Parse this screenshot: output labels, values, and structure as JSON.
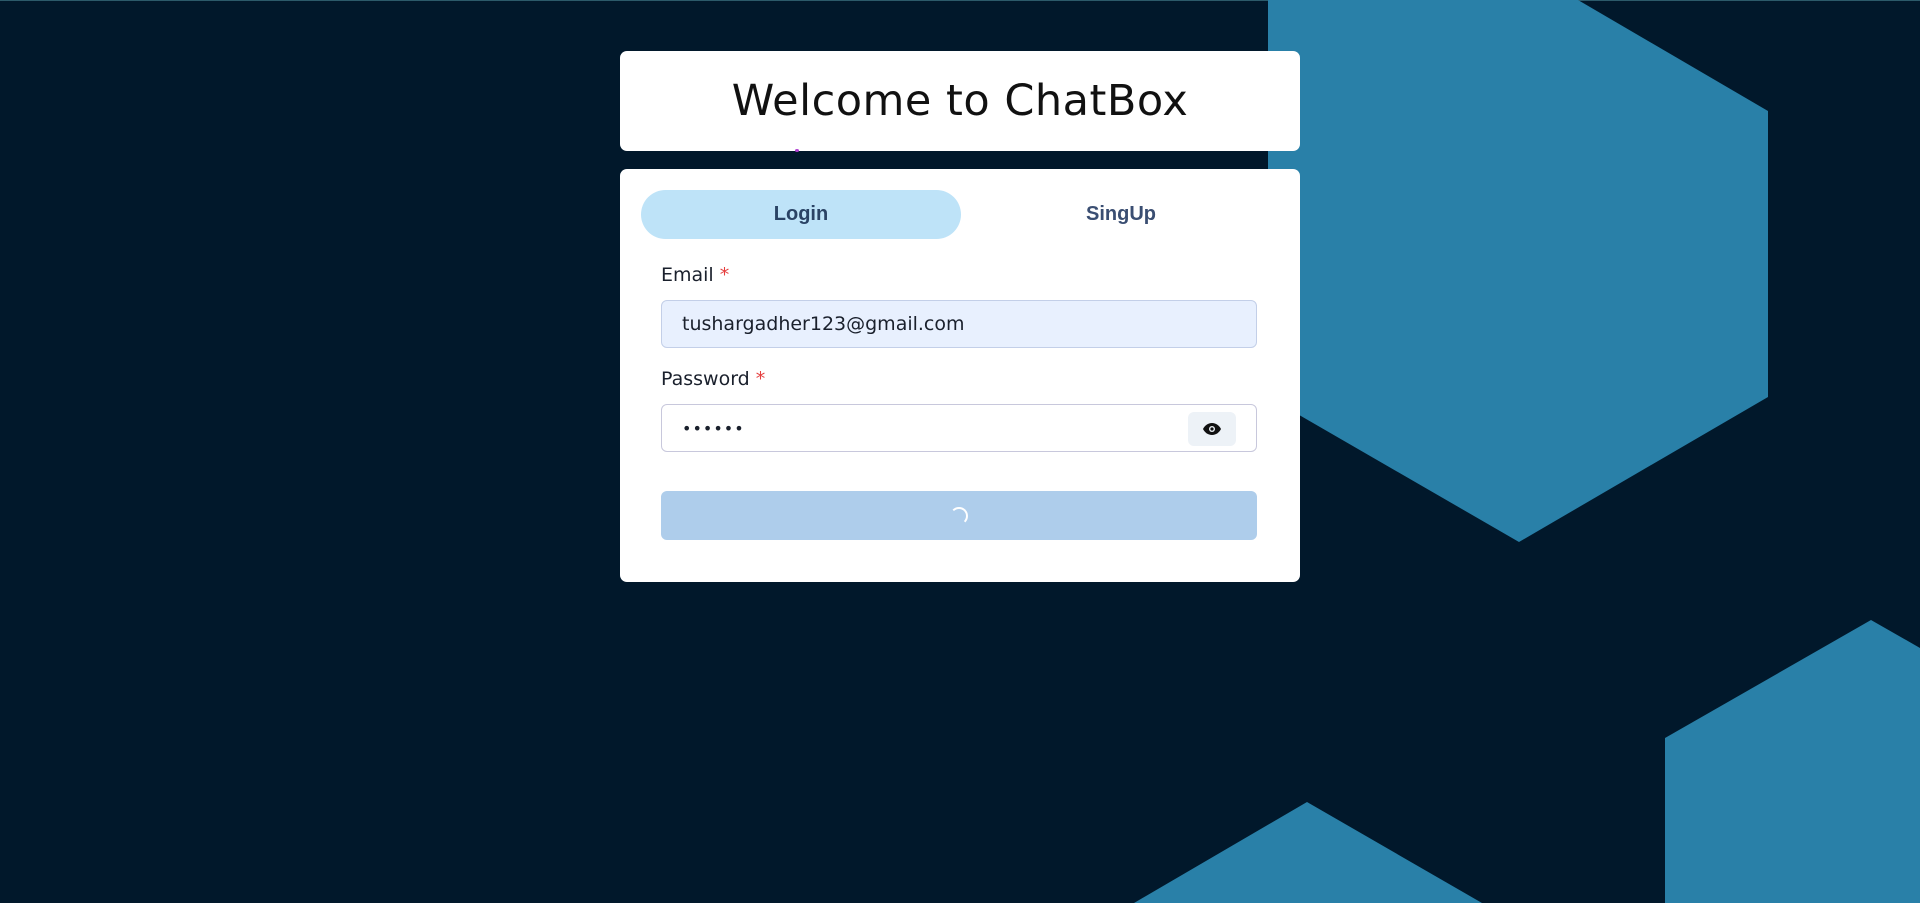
{
  "page": {
    "background_color": "#01182b",
    "hexagon_color": "#2980a8"
  },
  "header": {
    "title": "Welcome to ChatBox"
  },
  "tabs": [
    {
      "label": "Login",
      "active": true
    },
    {
      "label": "SingUp",
      "active": false
    }
  ],
  "form": {
    "email": {
      "label": "Email",
      "required_mark": "*",
      "value": "tushargadher123@gmail.com"
    },
    "password": {
      "label": "Password",
      "required_mark": "*",
      "value": "••••••",
      "toggle_icon": "eye-icon"
    },
    "submit": {
      "state": "loading",
      "icon": "spinner-icon"
    }
  },
  "colors": {
    "accent_tab": "#bee3f8",
    "required": "#e53e3e",
    "submit_loading": "#aecdeb"
  }
}
